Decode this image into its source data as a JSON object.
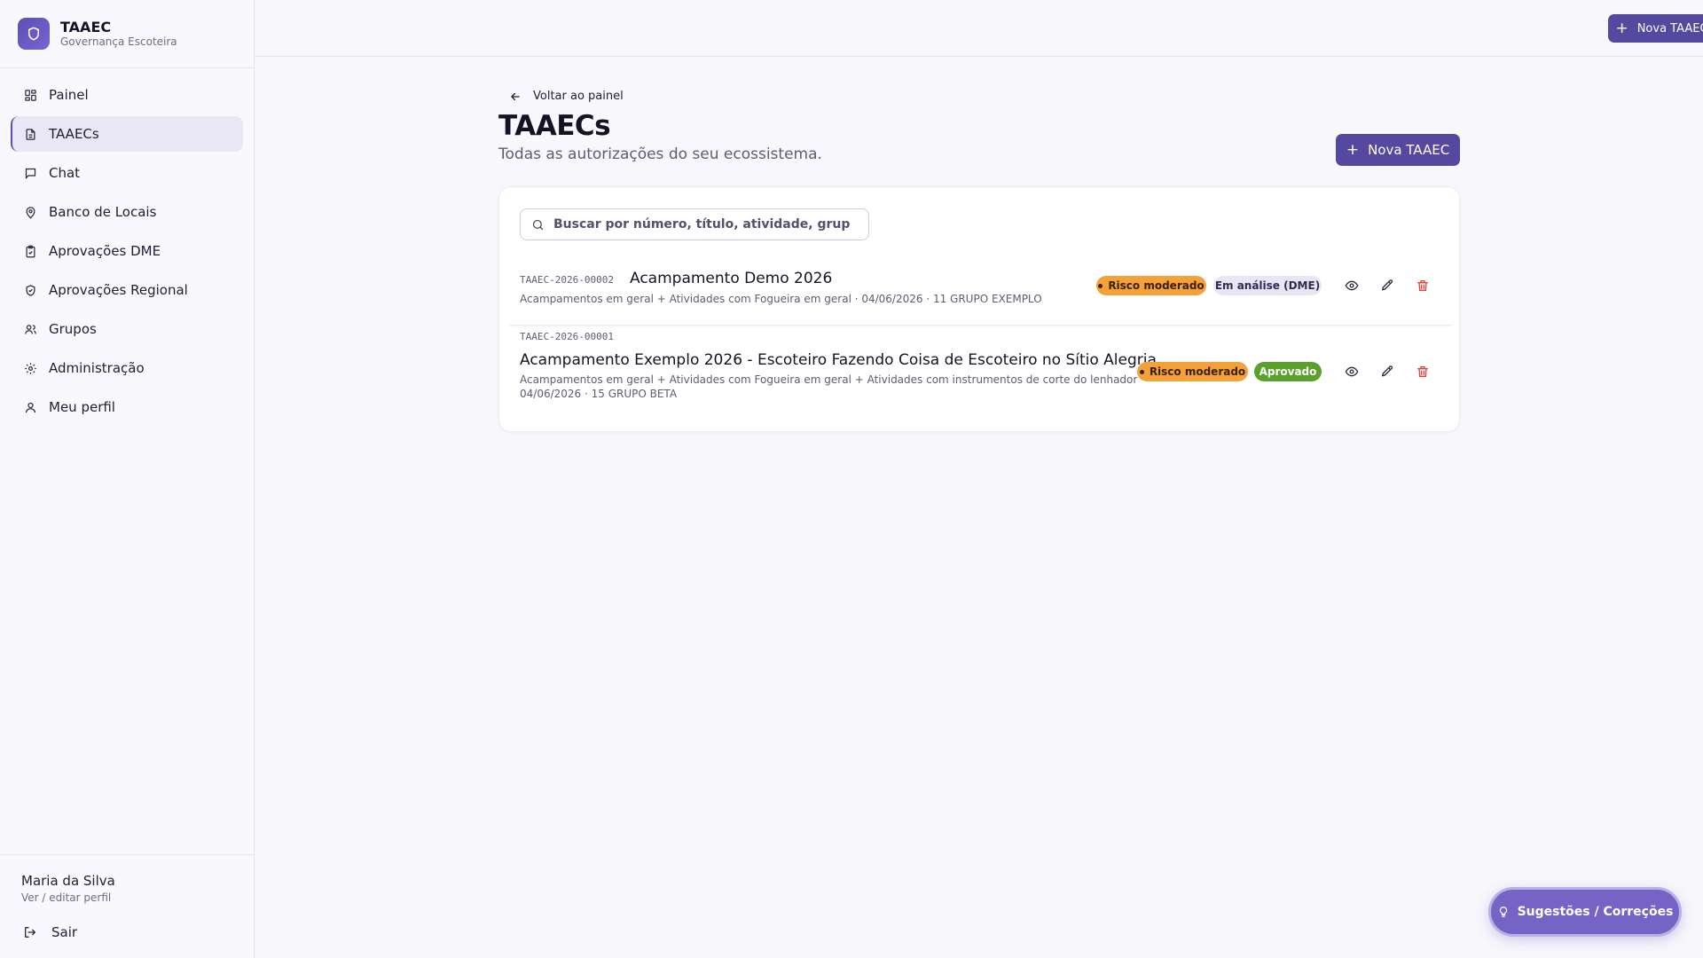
{
  "brand": {
    "title": "TAAEC",
    "subtitle": "Governança Escoteira"
  },
  "sidebar": {
    "items": [
      {
        "label": "Painel",
        "icon": "dashboard-icon",
        "active": false
      },
      {
        "label": "TAAECs",
        "icon": "document-icon",
        "active": true
      },
      {
        "label": "Chat",
        "icon": "chat-icon",
        "active": false
      },
      {
        "label": "Banco de Locais",
        "icon": "map-pin-icon",
        "active": false
      },
      {
        "label": "Aprovações DME",
        "icon": "clipboard-check-icon",
        "active": false
      },
      {
        "label": "Aprovações Regional",
        "icon": "shield-check-icon",
        "active": false
      },
      {
        "label": "Grupos",
        "icon": "users-icon",
        "active": false
      },
      {
        "label": "Administração",
        "icon": "gear-icon",
        "active": false
      },
      {
        "label": "Meu perfil",
        "icon": "user-icon",
        "active": false
      }
    ],
    "user": {
      "name": "Maria da Silva",
      "link": "Ver / editar perfil"
    },
    "logout": "Sair"
  },
  "topbar": {
    "new_label": "Nova TAAEC"
  },
  "main": {
    "back": "Voltar ao painel",
    "title": "TAAECs",
    "subtitle": "Todas as autorizações do seu ecossistema.",
    "new_label": "Nova TAAEC",
    "search": {
      "placeholder": "Buscar por número, título, atividade, grupo ou número",
      "value": ""
    },
    "rows": [
      {
        "code": "TAAEC-2026-00002",
        "title": "Acampamento Demo 2026",
        "meta": "Acampamentos em geral + Atividades com Fogueira em geral · 04/06/2026 · 11 GRUPO EXEMPLO",
        "risk": "Risco moderado",
        "status": "Em análise (DME)"
      },
      {
        "code": "TAAEC-2026-00001",
        "title": "Acampamento Exemplo 2026 - Escoteiro Fazendo Coisa de Escoteiro no Sítio Alegria",
        "meta_line1": "Acampamentos em geral + Atividades com Fogueira em geral + Atividades com instrumentos de corte do lenhador ·",
        "meta_line2": "04/06/2026 · 15 GRUPO BETA",
        "risk": "Risco moderado",
        "status": "Aprovado"
      }
    ]
  },
  "fab": {
    "label": "Sugestões / Correções"
  },
  "colors": {
    "accent": "#54489f",
    "risk": "#f4a13a",
    "approved": "#59a12b",
    "delete": "#e0453a"
  }
}
